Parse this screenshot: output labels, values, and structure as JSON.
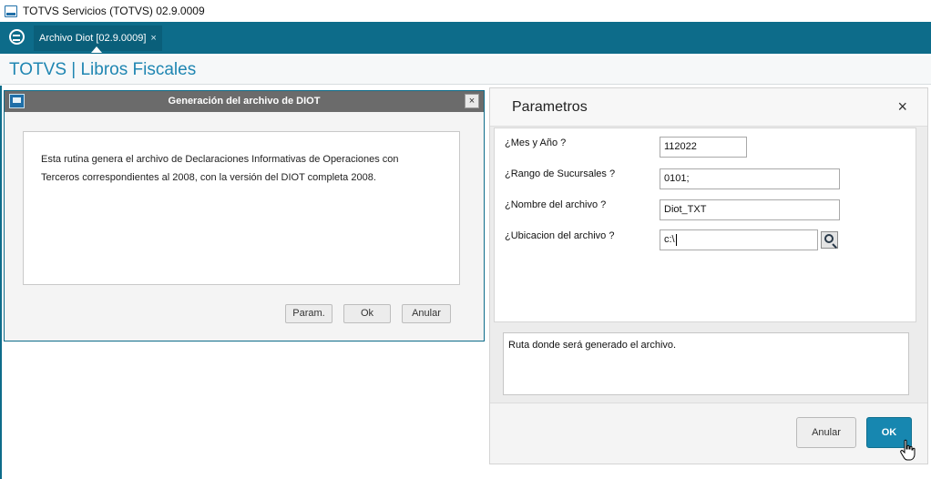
{
  "window": {
    "title": "TOTVS Servicios (TOTVS) 02.9.0009"
  },
  "tabbar": {
    "tab_label": "Archivo Diot [02.9.0009]",
    "tab_close": "×"
  },
  "module": {
    "title": "TOTVS | Libros Fiscales"
  },
  "dialog": {
    "title": "Generación del archivo de DIOT",
    "close": "×",
    "description_line1": "Esta rutina genera el archivo de Declaraciones Informativas de Operaciones con",
    "description_line2": "Terceros correspondientes al 2008, con la versión del DIOT completa 2008.",
    "buttons": {
      "param": "Param.",
      "ok": "Ok",
      "cancel": "Anular"
    }
  },
  "parameters": {
    "title": "Parametros",
    "close": "×",
    "fields": [
      {
        "label": "¿Mes y Año ?",
        "value": "112022"
      },
      {
        "label": "¿Rango de Sucursales ?",
        "value": "0101;"
      },
      {
        "label": "¿Nombre del archivo ?",
        "value": "Diot_TXT"
      },
      {
        "label": "¿Ubicacion del archivo ?",
        "value": "c:\\"
      }
    ],
    "help_text": "Ruta donde será generado el archivo.",
    "buttons": {
      "cancel": "Anular",
      "ok": "OK"
    }
  },
  "colors": {
    "accent": "#0d6c8a",
    "brand_title": "#1f86b2",
    "ok_button": "#1787b0"
  }
}
